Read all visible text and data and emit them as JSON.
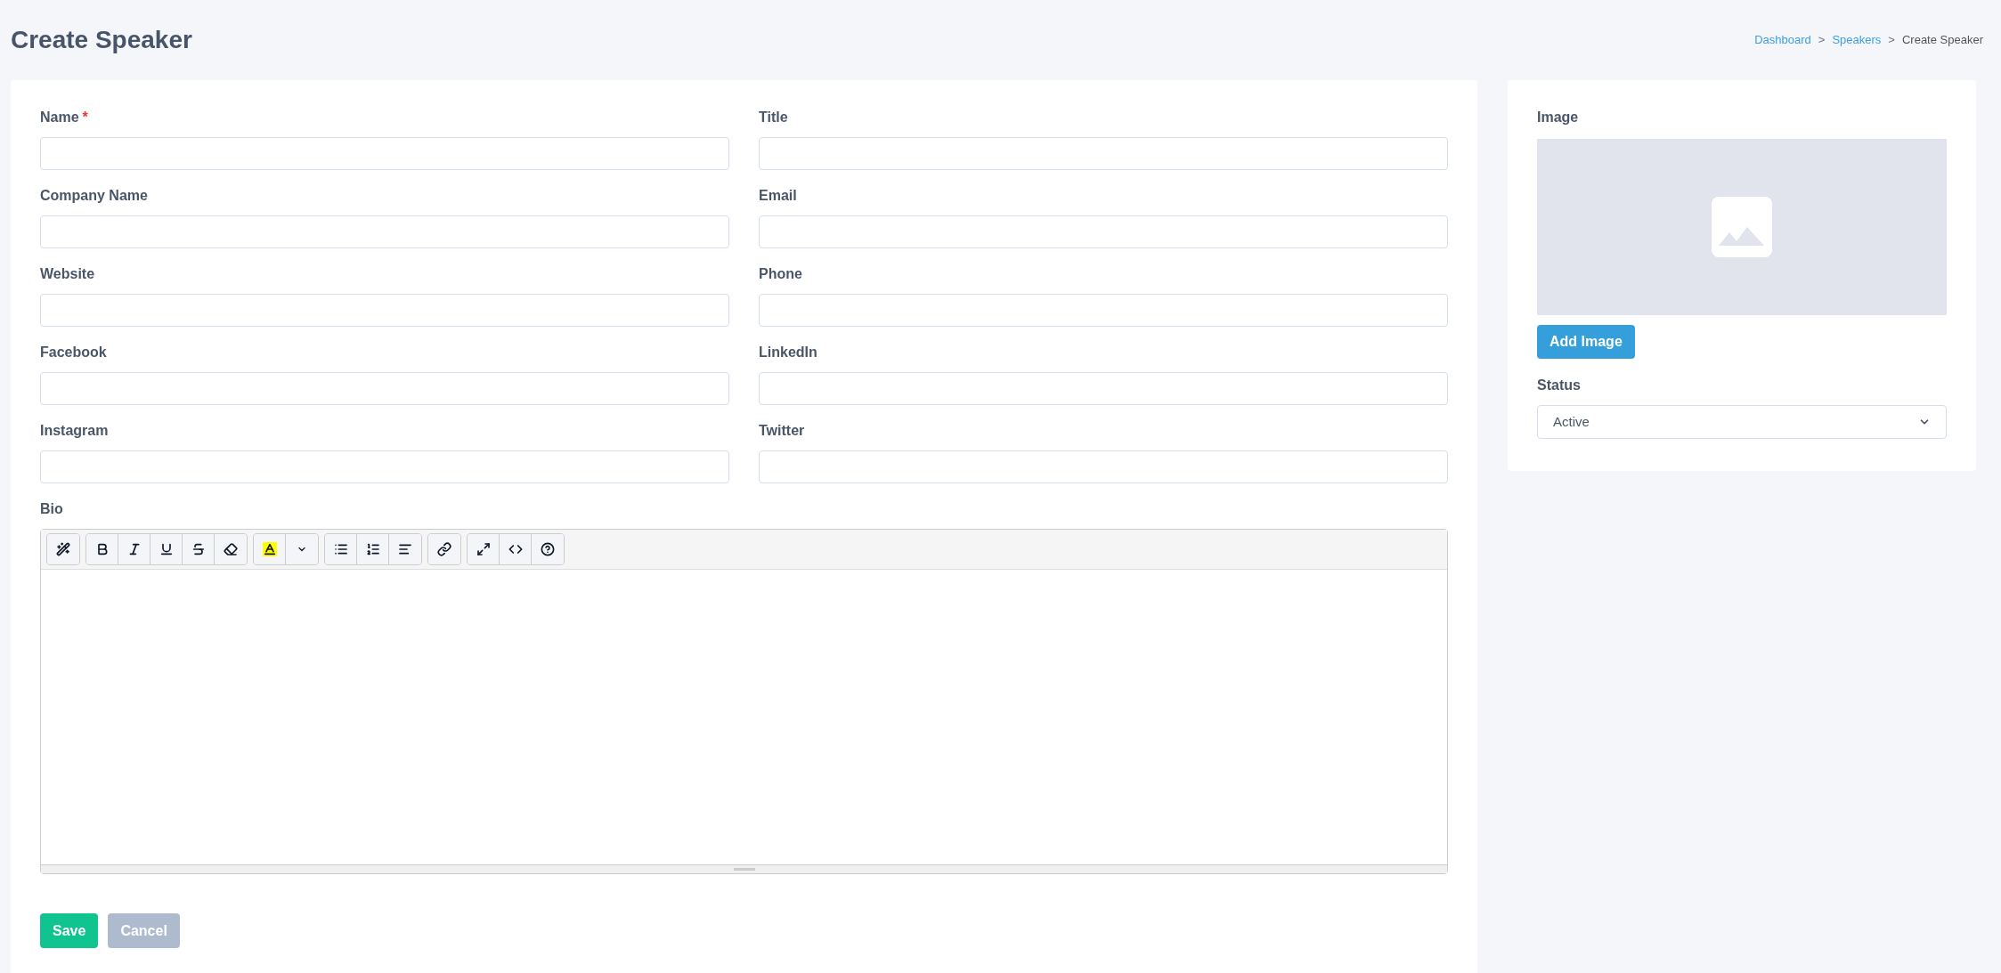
{
  "page_title": "Create Speaker",
  "breadcrumb": [
    {
      "label": "Dashboard",
      "kind": "link"
    },
    {
      "label": "Speakers",
      "kind": "link"
    },
    {
      "label": "Create Speaker",
      "kind": "current"
    }
  ],
  "fields": [
    {
      "label": "Name",
      "required_marker": "*"
    },
    {
      "label": "Title"
    },
    {
      "label": "Company Name"
    },
    {
      "label": "Email"
    },
    {
      "label": "Website"
    },
    {
      "label": "Phone"
    },
    {
      "label": "Facebook"
    },
    {
      "label": "LinkedIn"
    },
    {
      "label": "Instagram"
    },
    {
      "label": "Twitter"
    }
  ],
  "breadcrumb_separator": ">",
  "bio": {
    "label": "Bio",
    "toolbar": [
      [
        {
          "kind": "style"
        }
      ],
      [
        {
          "kind": "bold"
        },
        {
          "kind": "italic"
        },
        {
          "kind": "underline"
        },
        {
          "kind": "strikethrough"
        },
        {
          "kind": "eraser"
        }
      ],
      [
        {
          "kind": "highlight"
        },
        {
          "kind": "caret"
        }
      ],
      [
        {
          "kind": "bullets"
        },
        {
          "kind": "numbers"
        },
        {
          "kind": "align"
        }
      ],
      [
        {
          "kind": "link"
        }
      ],
      [
        {
          "kind": "fullscreen"
        },
        {
          "kind": "code"
        },
        {
          "kind": "help"
        }
      ]
    ]
  },
  "actions": [
    {
      "label": "Save",
      "kind": "primary"
    },
    {
      "label": "Cancel",
      "kind": "secondary"
    }
  ],
  "image": {
    "label": "Image",
    "button": "Add Image"
  },
  "status": {
    "label": "Status",
    "value": "Active"
  }
}
